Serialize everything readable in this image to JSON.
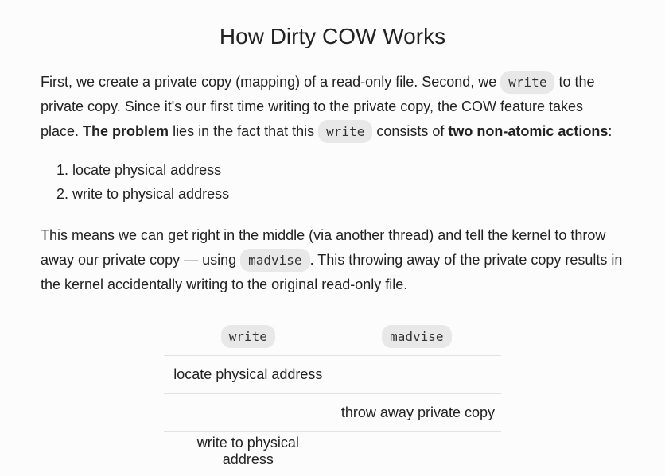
{
  "title": "How Dirty COW Works",
  "p1": {
    "t1": "First, we create a private copy (mapping) of a read-only file. Second, we ",
    "code1": "write",
    "t2": " to the private copy. Since it's our first time writing to the private copy, the COW feature takes place. ",
    "bold1": "The problem",
    "t3": " lies in the fact that this ",
    "code2": "write",
    "t4": " consists of ",
    "bold2": "two non-atomic actions",
    "t5": ":"
  },
  "steps": [
    "locate physical address",
    "write to physical address"
  ],
  "p2": {
    "t1": "This means we can get right in the middle (via another thread) and tell the kernel to throw away our private copy — using ",
    "code1": "madvise",
    "t2": ". This throwing away of the private copy results in the kernel accidentally writing to the original read-only file."
  },
  "table": {
    "headers": [
      "write",
      "madvise"
    ],
    "rows": [
      [
        "locate physical address",
        ""
      ],
      [
        "",
        "throw away private copy"
      ],
      [
        "write to physical address",
        ""
      ]
    ]
  }
}
